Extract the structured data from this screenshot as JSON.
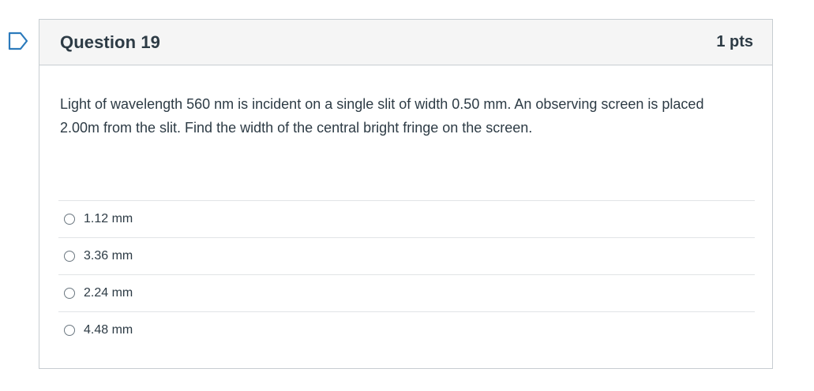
{
  "question": {
    "title": "Question 19",
    "points": "1 pts",
    "text": "Light of wavelength 560 nm is incident on a single slit of width 0.50 mm. An observing screen is placed 2.00m from the slit. Find the width of the central bright fringe on the screen."
  },
  "answers": [
    {
      "label": "1.12 mm"
    },
    {
      "label": "3.36 mm"
    },
    {
      "label": "2.24 mm"
    },
    {
      "label": "4.48 mm"
    }
  ],
  "colors": {
    "flag": "#2b7abc",
    "header_bg": "#f5f5f5",
    "border": "#c7cdd1",
    "text": "#2d3b45"
  },
  "icons": {
    "flag": "flag-question-icon"
  }
}
